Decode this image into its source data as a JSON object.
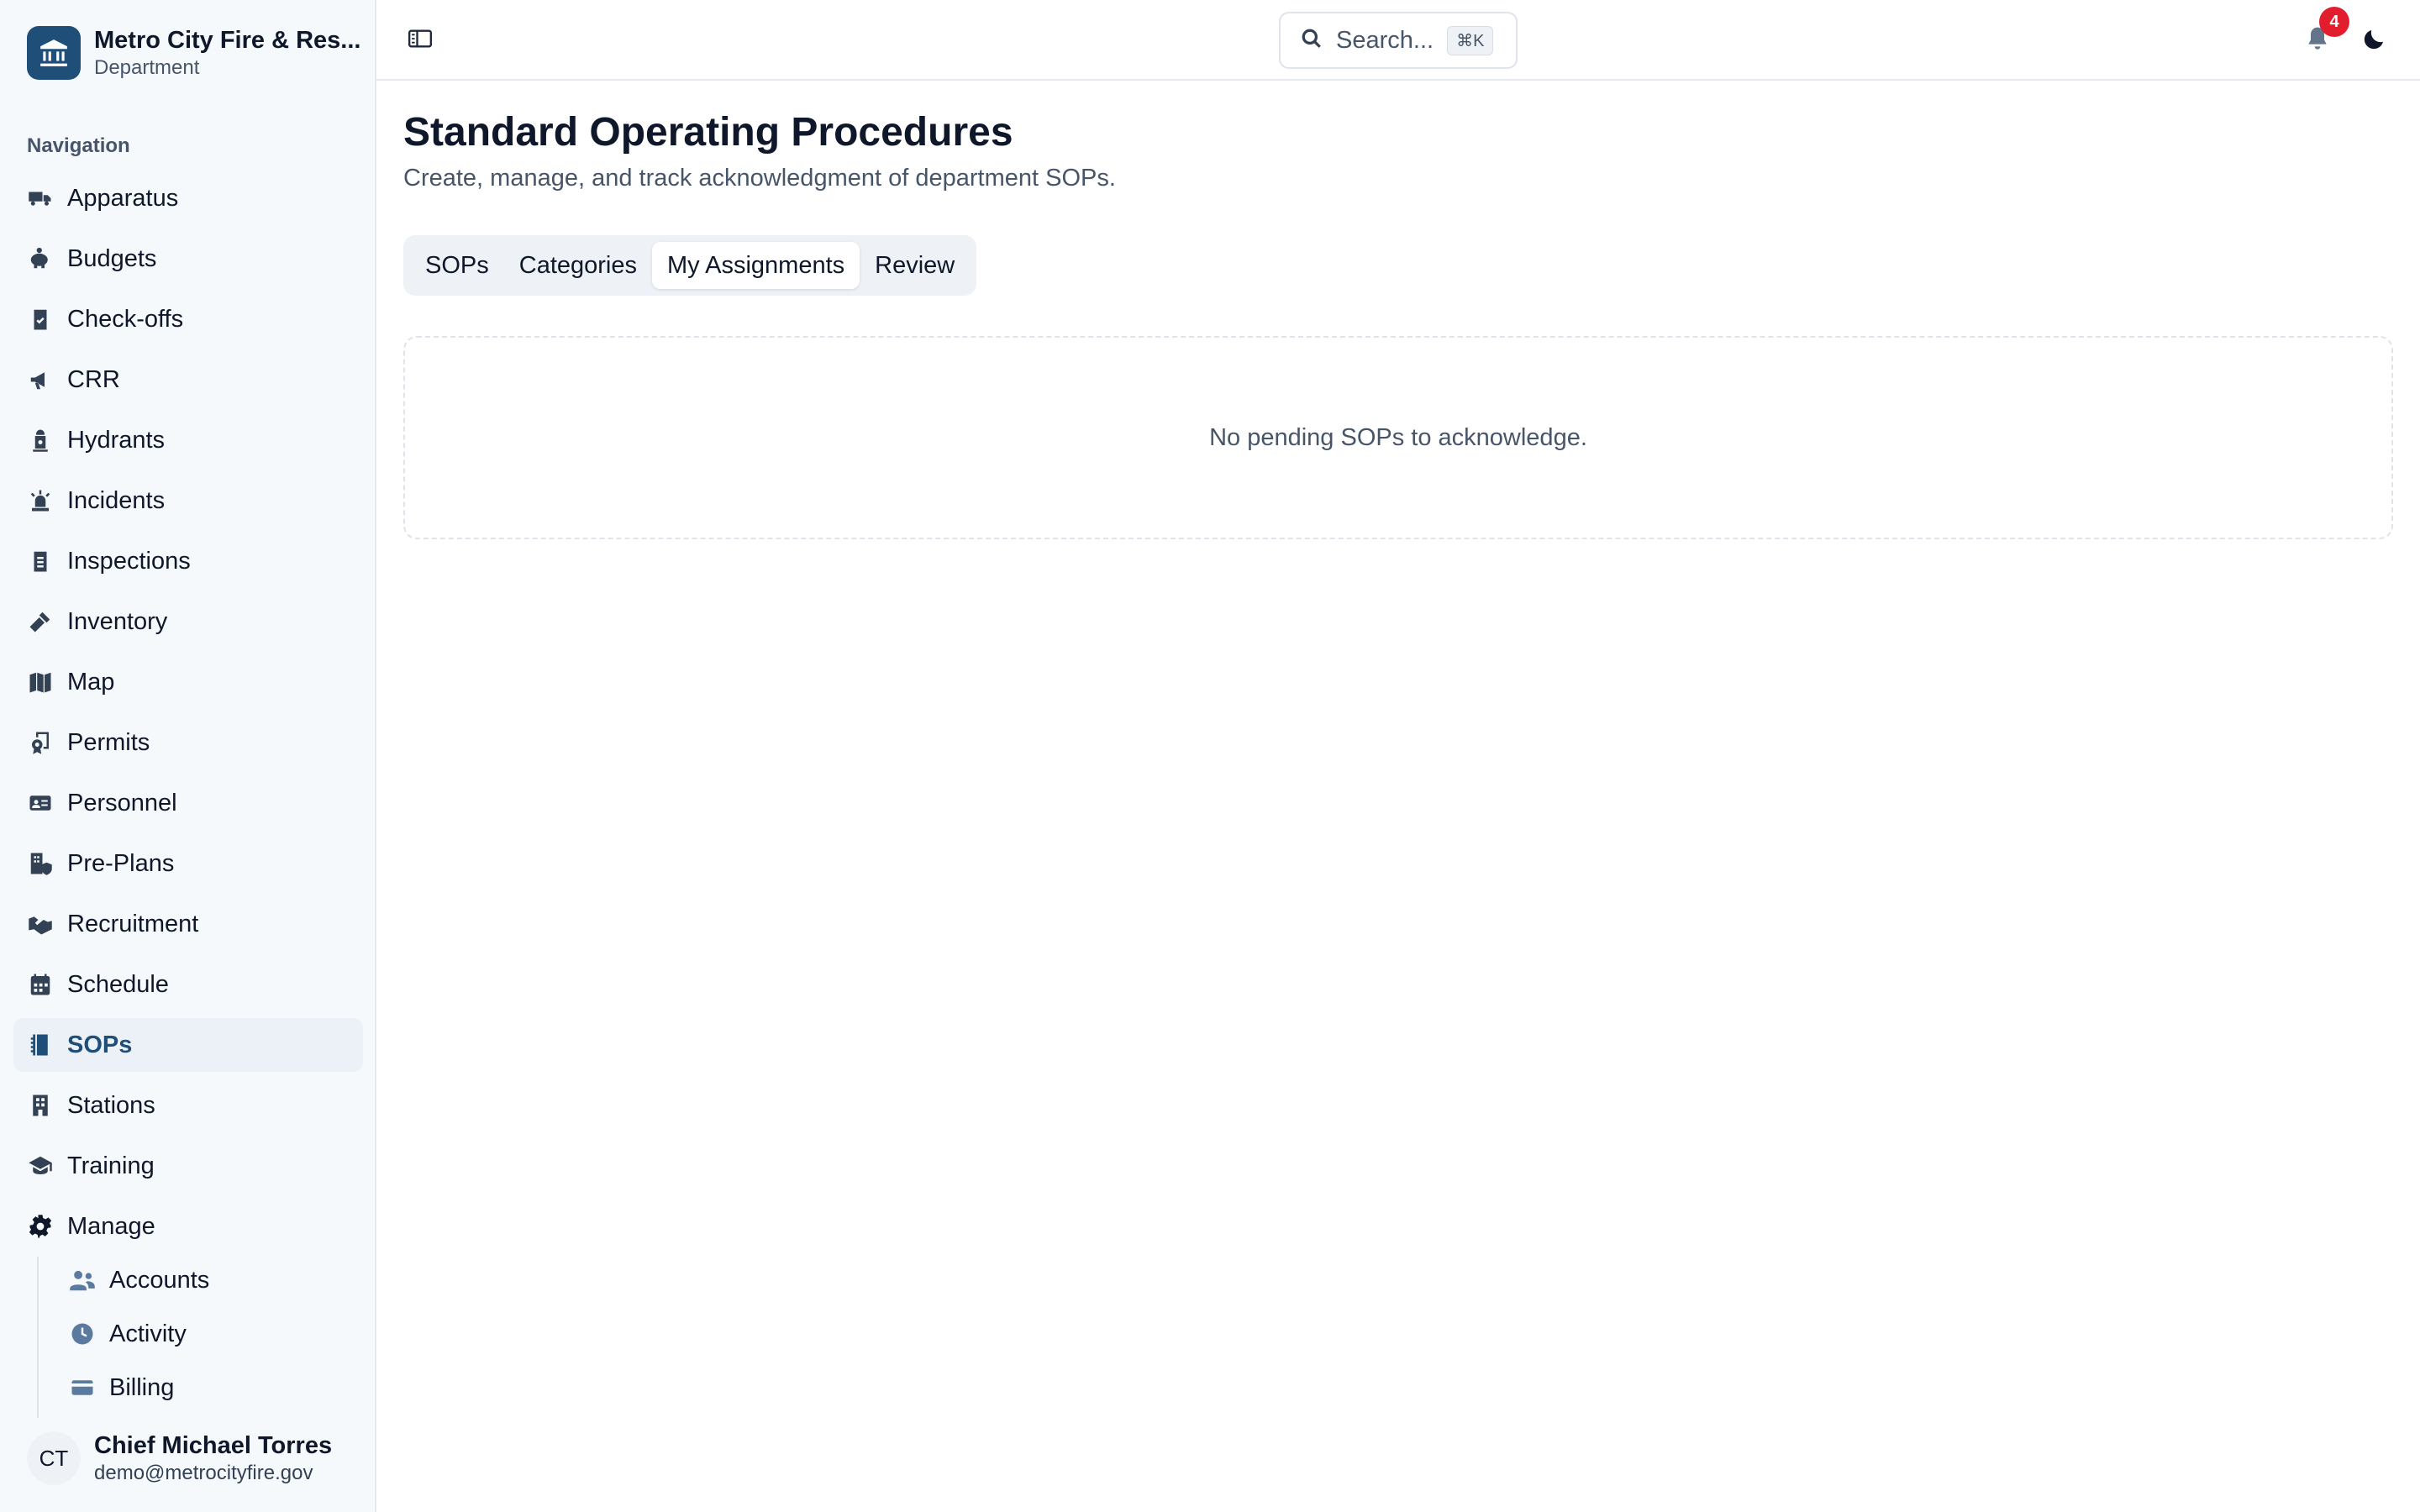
{
  "org": {
    "name": "Metro City Fire & Res...",
    "type": "Department"
  },
  "nav": {
    "heading": "Navigation",
    "items": [
      {
        "label": "Apparatus",
        "icon": "fire-truck-icon"
      },
      {
        "label": "Budgets",
        "icon": "piggy-bank-icon"
      },
      {
        "label": "Check-offs",
        "icon": "clipboard-check-icon"
      },
      {
        "label": "CRR",
        "icon": "megaphone-icon"
      },
      {
        "label": "Hydrants",
        "icon": "hydrant-icon"
      },
      {
        "label": "Incidents",
        "icon": "siren-icon"
      },
      {
        "label": "Inspections",
        "icon": "clipboard-list-icon"
      },
      {
        "label": "Inventory",
        "icon": "tools-icon"
      },
      {
        "label": "Map",
        "icon": "map-icon"
      },
      {
        "label": "Permits",
        "icon": "certificate-icon"
      },
      {
        "label": "Personnel",
        "icon": "id-card-icon"
      },
      {
        "label": "Pre-Plans",
        "icon": "building-shield-icon"
      },
      {
        "label": "Recruitment",
        "icon": "handshake-icon"
      },
      {
        "label": "Schedule",
        "icon": "calendar-icon"
      },
      {
        "label": "SOPs",
        "icon": "book-icon",
        "active": true
      },
      {
        "label": "Stations",
        "icon": "building-icon"
      },
      {
        "label": "Training",
        "icon": "graduation-cap-icon"
      },
      {
        "label": "Manage",
        "icon": "gear-icon"
      }
    ],
    "sub_items": [
      {
        "label": "Accounts",
        "icon": "users-icon"
      },
      {
        "label": "Activity",
        "icon": "clock-icon"
      },
      {
        "label": "Billing",
        "icon": "credit-card-icon"
      }
    ]
  },
  "user": {
    "initials": "CT",
    "name": "Chief Michael Torres",
    "email": "demo@metrocityfire.gov"
  },
  "topbar": {
    "search_label": "Search...",
    "search_shortcut": "⌘K",
    "notification_count": "4"
  },
  "page": {
    "title": "Standard Operating Procedures",
    "subtitle": "Create, manage, and track acknowledgment of department SOPs.",
    "tabs": [
      {
        "label": "SOPs"
      },
      {
        "label": "Categories"
      },
      {
        "label": "My Assignments",
        "active": true
      },
      {
        "label": "Review"
      }
    ],
    "empty_message": "No pending SOPs to acknowledge."
  },
  "colors": {
    "brand": "#1f4e79",
    "badge": "#e11d2e",
    "sidebar_bg": "#f6f9fc"
  }
}
